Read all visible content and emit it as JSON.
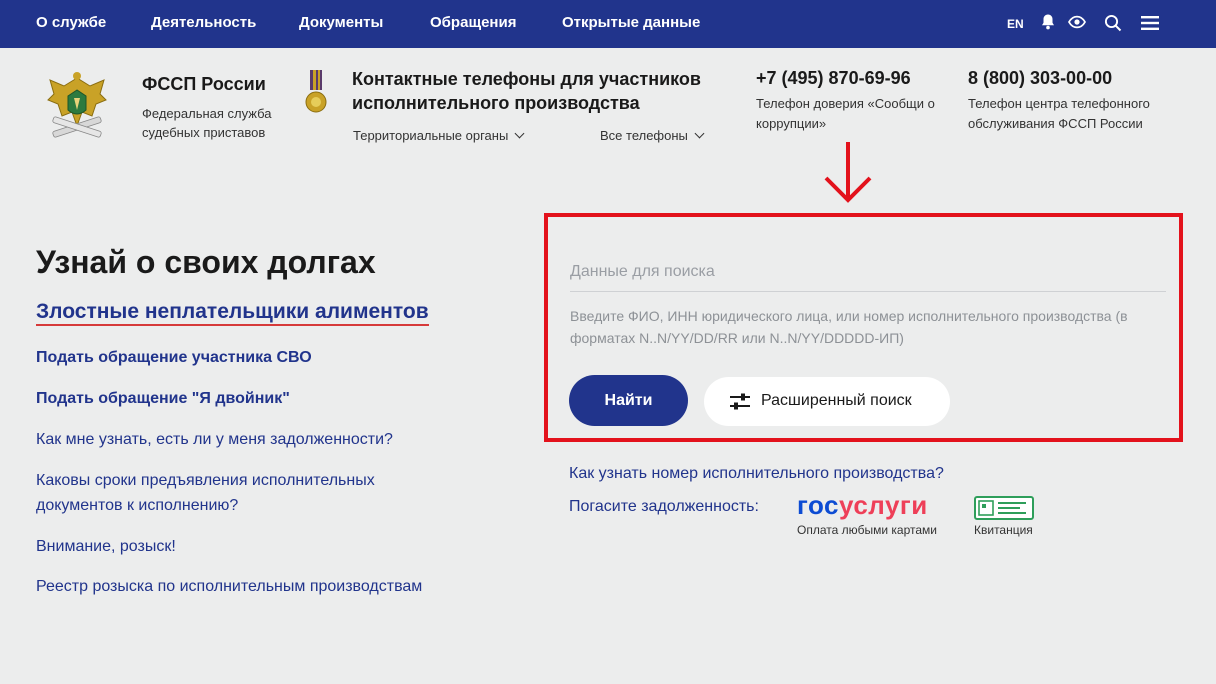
{
  "topnav": {
    "items": [
      "О службе",
      "Деятельность",
      "Документы",
      "Обращения",
      "Открытые данные"
    ],
    "lang": "EN",
    "icons": [
      "bell-icon",
      "eye-icon",
      "search-icon",
      "menu-icon"
    ]
  },
  "header": {
    "org_title": "ФССП России",
    "org_subtitle": "Федеральная служба судебных приставов",
    "contacts_title": "Контактные телефоны для участников исполнительного производства",
    "dropdowns": [
      "Территориальные органы",
      "Все телефоны"
    ],
    "phones": [
      {
        "number": "+7 (495) 870-69-96",
        "caption": "Телефон доверия «Сообщи о коррупции»"
      },
      {
        "number": "8 (800) 303-00-00",
        "caption": "Телефон центра телефонного обслуживания ФССП России"
      }
    ]
  },
  "left": {
    "heading": "Узнай о своих долгах",
    "highlight_link": "Злостные неплательщики алиментов",
    "links": [
      "Подать обращение участника СВО",
      "Подать обращение \"Я двойник\"",
      "Как мне узнать, есть ли у меня задолженности?",
      "Каковы сроки предъявления исполнительных документов к исполнению?",
      "Внимание, розыск!",
      "Реестр розыска по исполнительным производствам"
    ]
  },
  "search": {
    "placeholder": "Данные для поиска",
    "value": "",
    "hint": "Введите ФИО, ИНН юридического лица, или номер исполнительного производства (в форматах N..N/YY/DD/RR или N..N/YY/DDDDD-ИП)",
    "find_label": "Найти",
    "advanced_label": "Расширенный поиск"
  },
  "below_search": {
    "howto_link": "Как узнать номер исполнительного производства?",
    "pay_label": "Погасите задолженность:",
    "gos_part1": "гос",
    "gos_part2": "услуги",
    "gos_caption": "Оплата любыми картами",
    "receipt_caption": "Квитанция"
  },
  "colors": {
    "nav_bg": "#21348c",
    "link": "#21348c",
    "highlight_border": "#e3121c",
    "underline_red": "#d63a3a",
    "gos_blue": "#0d4cd3",
    "gos_red": "#ee3f58",
    "page_bg": "#eceded"
  }
}
